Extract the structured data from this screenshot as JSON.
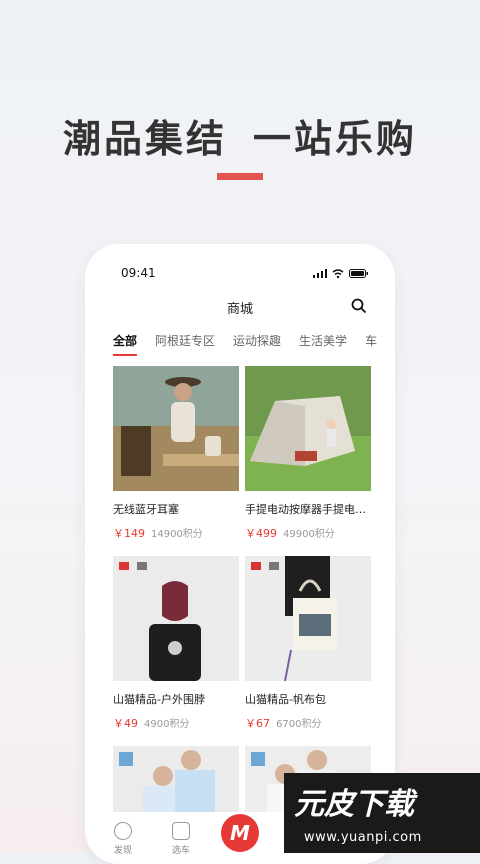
{
  "headline": {
    "left": "潮品集结",
    "right": "一站乐购"
  },
  "status_bar": {
    "time": "09:41"
  },
  "nav": {
    "title": "商城"
  },
  "tabs": [
    "全部",
    "阿根廷专区",
    "运动探趣",
    "生活美学",
    "车"
  ],
  "products": [
    {
      "name": "无线蓝牙耳塞",
      "price": "￥149",
      "points": "14900积分"
    },
    {
      "name": "手提电动按摩器手提电…",
      "price": "￥499",
      "points": "49900积分"
    },
    {
      "name": "山猫精品-户外围脖",
      "price": "￥49",
      "points": "4900积分"
    },
    {
      "name": "山猫精品-帆布包",
      "price": "￥67",
      "points": "6700积分"
    }
  ],
  "bottom_tabs": {
    "discover": "发现",
    "car": "选车"
  },
  "watermark": {
    "brand": "元皮下载",
    "url": "www.yuanpi.com"
  },
  "colors": {
    "accent": "#e53935",
    "headline_bar": "#e25550"
  }
}
